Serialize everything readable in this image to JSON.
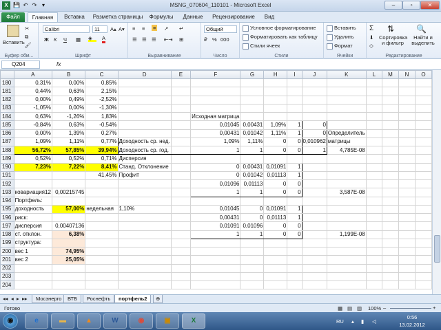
{
  "window": {
    "title": "MSNG_070604_110101 - Microsoft Excel",
    "min": "–",
    "max": "▫",
    "close": "✕"
  },
  "qat": {
    "save": "💾",
    "undo": "↶",
    "redo": "↷",
    "more": "▾"
  },
  "tabs": [
    "Файл",
    "Главная",
    "Вставка",
    "Разметка страницы",
    "Формулы",
    "Данные",
    "Рецензирование",
    "Вид"
  ],
  "ribbon": {
    "paste": "Вставить",
    "clipboard": "Буфер обм...",
    "font_group": "Шрифт",
    "font_name": "Calibri",
    "font_size": "11",
    "bold": "Ж",
    "italic": "К",
    "underline": "Ч",
    "align_group": "Выравнивание",
    "number_format": "Общий",
    "number_group": "Число",
    "cond_format": "Условное форматирование",
    "format_table": "Форматировать как таблицу",
    "cell_styles": "Стили ячеек",
    "styles_group": "Стили",
    "insert": "Вставить",
    "delete": "Удалить",
    "format": "Формат",
    "cells_group": "Ячейки",
    "sigma": "Σ",
    "sort": "Сортировка и фильтр",
    "find": "Найти и выделить",
    "edit_group": "Редактирование",
    "percent": "%",
    "thousands": "000"
  },
  "formula_bar": {
    "name_box": "Q204",
    "fx": "fx",
    "formula": ""
  },
  "columns": [
    "A",
    "B",
    "C",
    "D",
    "E",
    "F",
    "G",
    "H",
    "I",
    "J",
    "K",
    "L",
    "M",
    "N",
    "O"
  ],
  "rows": [
    {
      "n": "180",
      "cells": {
        "A": "0,31%",
        "B": "0,00%",
        "C": "0,85%"
      }
    },
    {
      "n": "181",
      "cells": {
        "A": "0,44%",
        "B": "0,63%",
        "C": "2,15%"
      }
    },
    {
      "n": "182",
      "cells": {
        "A": "0,00%",
        "B": "0,49%",
        "C": "-2,52%"
      }
    },
    {
      "n": "183",
      "cells": {
        "A": "-1,05%",
        "B": "0,00%",
        "C": "-1,30%"
      }
    },
    {
      "n": "184",
      "cells": {
        "A": "0,63%",
        "B": "-1,26%",
        "C": "1,83%",
        "F": "Исходная матрица"
      }
    },
    {
      "n": "185",
      "cells": {
        "A": "-0,84%",
        "B": "0,63%",
        "C": "-0,54%",
        "F": "0,01045",
        "G": "0,00431",
        "H": "1,09%",
        "I": "1",
        "J": "0"
      }
    },
    {
      "n": "186",
      "cells": {
        "A": "0,00%",
        "B": "1,39%",
        "C": "0,27%",
        "F": "0,00431",
        "G": "0,01042",
        "H": "1,11%",
        "I": "1",
        "J": "0",
        "K": "Определитель"
      }
    },
    {
      "n": "187",
      "cells": {
        "A": "1,09%",
        "B": "1,11%",
        "C": "0,77%",
        "D": "Доходность ср. нед.",
        "F": "1,09%",
        "G": "1,11%",
        "H": "0",
        "I": "0",
        "J": "0,010962",
        "K": "матрицы"
      }
    },
    {
      "n": "188",
      "cells": {
        "A": "56,72%",
        "B": "57,85%",
        "C": "39,94%",
        "D": "Доходность ср. год.",
        "F": "1",
        "G": "1",
        "H": "0",
        "I": "0",
        "J": "1",
        "K": "4,785E-08"
      }
    },
    {
      "n": "189",
      "cells": {
        "A": "0,52%",
        "B": "0,52%",
        "C": "0,71%",
        "D": "Дисперсия"
      }
    },
    {
      "n": "190",
      "cells": {
        "A": "7,23%",
        "B": "7,22%",
        "C": "8,41%",
        "D": "Станд. Отклонение",
        "F": "0",
        "G": "0,00431",
        "H": "0,01091",
        "I": "1"
      }
    },
    {
      "n": "191",
      "cells": {
        "C": "41,45%",
        "D": "Профит",
        "F": "0",
        "G": "0,01042",
        "H": "0,01113",
        "I": "1"
      }
    },
    {
      "n": "192",
      "cells": {
        "F": "0,01096",
        "G": "0,01113",
        "H": "0",
        "I": "0"
      }
    },
    {
      "n": "193",
      "cells": {
        "A": "ковариация12",
        "B": "0,00215745",
        "F": "1",
        "G": "1",
        "H": "0",
        "I": "0",
        "K": "3,587E-08"
      }
    },
    {
      "n": "194",
      "cells": {
        "A": "Портфель:"
      }
    },
    {
      "n": "195",
      "cells": {
        "A": "доходность",
        "B": "57,00%",
        "C": "недельная",
        "D": "1,10%",
        "F": "0,01045",
        "G": "0",
        "H": "0,01091",
        "I": "1"
      }
    },
    {
      "n": "196",
      "cells": {
        "A": "риск:",
        "F": "0,00431",
        "G": "0",
        "H": "0,01113",
        "I": "1"
      }
    },
    {
      "n": "197",
      "cells": {
        "A": "дисперсия",
        "B": "0,00407136",
        "F": "0,01091",
        "G": "0,01096",
        "H": "0",
        "I": "0"
      }
    },
    {
      "n": "198",
      "cells": {
        "A": "ст. отклон.",
        "B": "6,38%",
        "F": "1",
        "G": "1",
        "H": "0",
        "I": "0",
        "K": "1,199E-08"
      }
    },
    {
      "n": "199",
      "cells": {
        "A": "структура:"
      }
    },
    {
      "n": "200",
      "cells": {
        "A": "вес 1",
        "B": "74,95%"
      }
    },
    {
      "n": "201",
      "cells": {
        "A": "вес 2",
        "B": "25,05%"
      }
    },
    {
      "n": "202",
      "cells": {}
    },
    {
      "n": "203",
      "cells": {}
    },
    {
      "n": "204",
      "cells": {}
    }
  ],
  "sheets": [
    "Мосэнерго",
    "ВТБ",
    "Роснефть",
    "портфель2"
  ],
  "status": {
    "ready": "Готово",
    "zoom": "100%",
    "minus": "–",
    "plus": "+"
  },
  "taskbar": {
    "lang": "RU",
    "time": "0:56",
    "date": "13.02.2012"
  },
  "nav_arrows": {
    "first": "◂◂",
    "prev": "◂",
    "next": "▸",
    "last": "▸▸"
  }
}
